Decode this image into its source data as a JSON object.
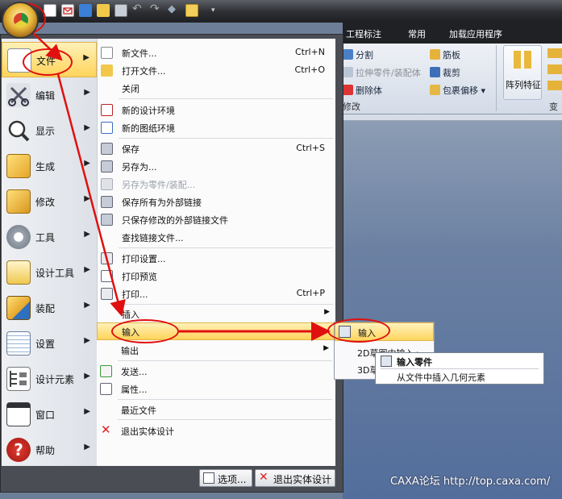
{
  "quick_access": {
    "icons": [
      "new-file-icon",
      "mail-icon",
      "network-icon",
      "open-folder-icon",
      "save-icon",
      "undo-icon",
      "redo-icon",
      "diamond-icon",
      "tree-icon",
      "dropdown-arrow-icon"
    ]
  },
  "ribbon": {
    "tabs": [
      "工程标注",
      "常用",
      "加载应用程序"
    ],
    "left_group": {
      "items": [
        "分割",
        "拉伸零件/装配体",
        "删除体"
      ],
      "rib": "筋板",
      "cut": "裁剪",
      "shell": "包裹偏移",
      "footer": "修改"
    },
    "array_label": "阵列特征",
    "right_footer": "变"
  },
  "left_menu": [
    {
      "label": "文件",
      "icon": "file-icon"
    },
    {
      "label": "编辑",
      "icon": "scissors-icon"
    },
    {
      "label": "显示",
      "icon": "zoom-icon"
    },
    {
      "label": "生成",
      "icon": "generate-solid-icon"
    },
    {
      "label": "修改",
      "icon": "modify-solid-icon"
    },
    {
      "label": "工具",
      "icon": "gear-icon"
    },
    {
      "label": "设计工具",
      "icon": "design-tools-icon"
    },
    {
      "label": "装配",
      "icon": "assembly-icon"
    },
    {
      "label": "设置",
      "icon": "settings-icon"
    },
    {
      "label": "设计元素",
      "icon": "design-element-icon"
    },
    {
      "label": "窗口",
      "icon": "window-icon"
    },
    {
      "label": "帮助",
      "icon": "help-icon"
    }
  ],
  "file_menu": {
    "new": {
      "label": "新文件...",
      "shortcut": "Ctrl+N"
    },
    "open": {
      "label": "打开文件...",
      "shortcut": "Ctrl+O"
    },
    "close": {
      "label": "关闭"
    },
    "new_env": {
      "label": "新的设计环境"
    },
    "new_drawing": {
      "label": "新的图纸环境"
    },
    "save": {
      "label": "保存",
      "shortcut": "Ctrl+S"
    },
    "save_as": {
      "label": "另存为..."
    },
    "save_as_part": {
      "label": "另存为零件/装配..."
    },
    "save_all_ext": {
      "label": "保存所有为外部链接"
    },
    "save_modified_ext": {
      "label": "只保存修改的外部链接文件"
    },
    "find_links": {
      "label": "查找链接文件..."
    },
    "print_setup": {
      "label": "打印设置..."
    },
    "print_preview": {
      "label": "打印预览"
    },
    "print": {
      "label": "打印...",
      "shortcut": "Ctrl+P"
    },
    "insert": {
      "label": "插入"
    },
    "import": {
      "label": "输入"
    },
    "export": {
      "label": "输出"
    },
    "send": {
      "label": "发送..."
    },
    "properties": {
      "label": "属性..."
    },
    "recent": {
      "label": "最近文件"
    },
    "exit_design": {
      "label": "退出实体设计"
    }
  },
  "import_submenu": {
    "items": [
      "输入",
      "2D草图中输入",
      "3D草"
    ]
  },
  "tooltip": {
    "title": "输入零件",
    "desc": "从文件中插入几何元素"
  },
  "bottom_buttons": {
    "options": "选项...",
    "exit": "退出实体设计"
  },
  "watermark": "CAXA论坛 http://top.caxa.com/",
  "colors": {
    "highlight": "#ffd45a",
    "annotation": "#e01010",
    "menu_frame": "#4a4d54"
  }
}
